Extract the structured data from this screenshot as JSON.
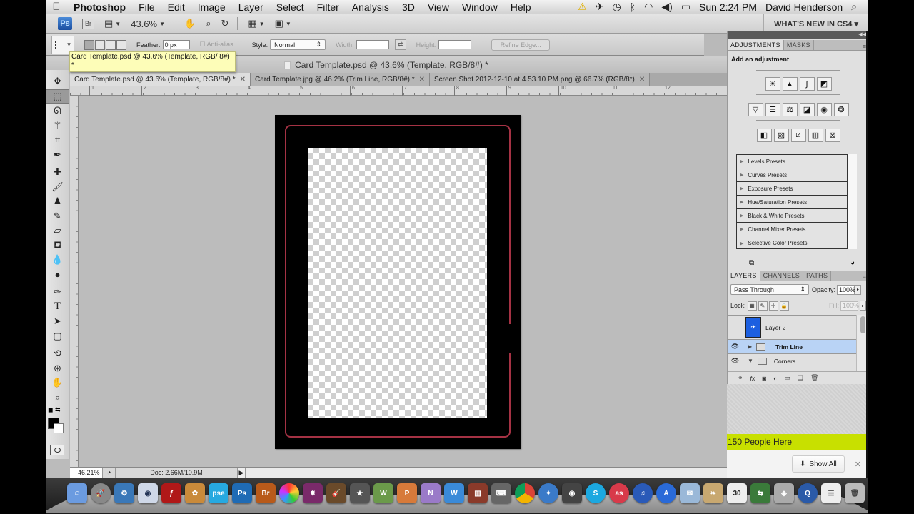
{
  "menubar": {
    "app_name": "Photoshop",
    "items": [
      "File",
      "Edit",
      "Image",
      "Layer",
      "Select",
      "Filter",
      "Analysis",
      "3D",
      "View",
      "Window",
      "Help"
    ],
    "status_icons": [
      "warning-icon",
      "fan-icon",
      "time-machine-icon",
      "bluetooth-icon",
      "wifi-icon",
      "volume-icon",
      "battery-icon"
    ],
    "clock": "Sun 2:24 PM",
    "user": "David Henderson"
  },
  "appbar": {
    "ps_label": "Ps",
    "br_label": "Br",
    "zoom_level": "43.6%",
    "whats_new": "WHAT'S NEW IN CS4 ▾"
  },
  "options": {
    "feather_label": "Feather:",
    "feather_value": "0 px",
    "antialias_label": "Anti-alias",
    "style_label": "Style:",
    "style_value": "Normal",
    "width_label": "Width:",
    "height_label": "Height:",
    "refine_edge": "Refine Edge..."
  },
  "tooltip": "Card Template.psd @ 43.6% (Template, RGB/ 8#) *",
  "document": {
    "window_title": "Card Template.psd @ 43.6% (Template, RGB/8#) *",
    "tabs": [
      {
        "label": "Card Template.psd @ 43.6% (Template, RGB/8#) *",
        "active": true
      },
      {
        "label": "Card Template.jpg @ 46.2% (Trim Line, RGB/8#) *",
        "active": false
      },
      {
        "label": "Screen Shot 2012-12-10 at 4.53.10 PM.png @ 66.7% (RGB/8*)",
        "active": false
      }
    ],
    "ruler_labels": [
      "1",
      "2",
      "3",
      "4",
      "5",
      "6",
      "7",
      "8",
      "9",
      "10",
      "11",
      "12"
    ]
  },
  "statusbar": {
    "zoom": "46.21%",
    "doc_info": "Doc: 2.66M/10.9M"
  },
  "adjustments": {
    "tabs": [
      "ADJUSTMENTS",
      "MASKS"
    ],
    "title": "Add an adjustment",
    "row1": [
      "brightness-contrast-icon",
      "levels-icon",
      "curves-icon",
      "exposure-icon"
    ],
    "row2": [
      "vibrance-icon",
      "hue-saturation-icon",
      "color-balance-icon",
      "black-white-icon",
      "photo-filter-icon",
      "channel-mixer-icon"
    ],
    "row3": [
      "invert-icon",
      "posterize-icon",
      "threshold-icon",
      "gradient-map-icon",
      "selective-color-icon"
    ],
    "presets": [
      "Levels Presets",
      "Curves Presets",
      "Exposure Presets",
      "Hue/Saturation Presets",
      "Black & White Presets",
      "Channel Mixer Presets",
      "Selective Color Presets"
    ]
  },
  "layers": {
    "tabs": [
      "LAYERS",
      "CHANNELS",
      "PATHS"
    ],
    "blend_mode": "Pass Through",
    "opacity_label": "Opacity:",
    "opacity": "100%",
    "lock_label": "Lock:",
    "fill_label": "Fill:",
    "fill": "100%",
    "items": [
      {
        "name": "Layer 2",
        "visible": false,
        "type": "layer"
      },
      {
        "name": "Trim Line",
        "visible": true,
        "type": "group",
        "selected": true,
        "expanded": false
      },
      {
        "name": "Corners",
        "visible": true,
        "type": "group",
        "selected": false,
        "expanded": true
      }
    ]
  },
  "browser": {
    "banner": "150 People Here",
    "show_all": "Show All"
  },
  "dock": {
    "apps": [
      "Finder",
      "Launchpad",
      "Automator",
      "Preview",
      "Flash",
      "iPhoto",
      "pse",
      "Ps",
      "Br",
      "Color",
      "Jingle",
      "GarageBand",
      "iMovie",
      "Word",
      "Powerpoint",
      "OneNote",
      "Word2",
      "Library",
      "Typewriter",
      "Chrome",
      "Safari",
      "FaceTime",
      "Skype",
      "Last.fm",
      "iTunes",
      "App Store",
      "Mail",
      "Books",
      "Calendar",
      "Switcher",
      "Photo Booth",
      "QuickTime",
      "Documents",
      "Trash"
    ],
    "calendar_day": "30"
  },
  "colors": {
    "trim_line": "#a53244",
    "banner": "#c8e000",
    "selected_layer": "#b9d3f5",
    "ps_blue": "#1b4fa0"
  }
}
